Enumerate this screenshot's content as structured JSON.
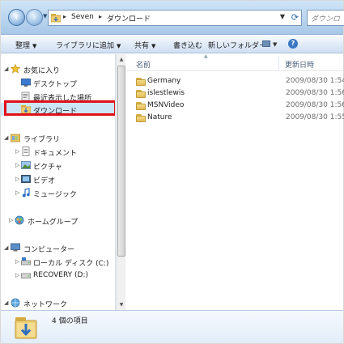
{
  "window": {
    "breadcrumb": [
      "Seven",
      "ダウンロード"
    ],
    "search_placeholder": "ダウンロ"
  },
  "commands": [
    {
      "label": "整理",
      "has_dropdown": true
    },
    {
      "label": "ライブラリに追加",
      "has_dropdown": true
    },
    {
      "label": "共有",
      "has_dropdown": true
    },
    {
      "label": "書き込む",
      "has_dropdown": false
    },
    {
      "label": "新しいフォルダー",
      "has_dropdown": false
    }
  ],
  "nav": {
    "favorites": {
      "label": "お気に入り",
      "items": [
        {
          "label": "デスクトップ",
          "icon": "desktop-icon"
        },
        {
          "label": "最近表示した場所",
          "icon": "recent-places-icon"
        },
        {
          "label": "ダウンロード",
          "icon": "download-folder-icon",
          "selected": true
        }
      ]
    },
    "libraries": {
      "label": "ライブラリ",
      "items": [
        {
          "label": "ドキュメント",
          "icon": "documents-icon"
        },
        {
          "label": "ピクチャ",
          "icon": "pictures-icon"
        },
        {
          "label": "ビデオ",
          "icon": "videos-icon"
        },
        {
          "label": "ミュージック",
          "icon": "music-icon"
        }
      ]
    },
    "homegroup": {
      "label": "ホームグループ"
    },
    "computer": {
      "label": "コンピューター",
      "items": [
        {
          "label": "ローカル ディスク (C:)",
          "icon": "local-disk-icon"
        },
        {
          "label": "RECOVERY (D:)",
          "icon": "recovery-drive-icon"
        }
      ]
    },
    "network": {
      "label": "ネットワーク"
    }
  },
  "content": {
    "columns": {
      "name": "名前",
      "modified": "更新日時"
    },
    "files": [
      {
        "name": "Germany",
        "modified": "2009/08/30 1:54",
        "icon": "folder-icon"
      },
      {
        "name": "islestlewis",
        "modified": "2009/08/30 1:56",
        "icon": "folder-icon"
      },
      {
        "name": "MSNVideo",
        "modified": "2009/08/30 1:56",
        "icon": "folder-icon"
      },
      {
        "name": "Nature",
        "modified": "2009/08/30 1:55",
        "icon": "folder-icon"
      }
    ]
  },
  "details": {
    "count_text": "4 個の項目"
  },
  "colors": {
    "highlight_border": "#e0101a",
    "selected_bg": "#cde6f7",
    "accent": "#3a78c3"
  }
}
